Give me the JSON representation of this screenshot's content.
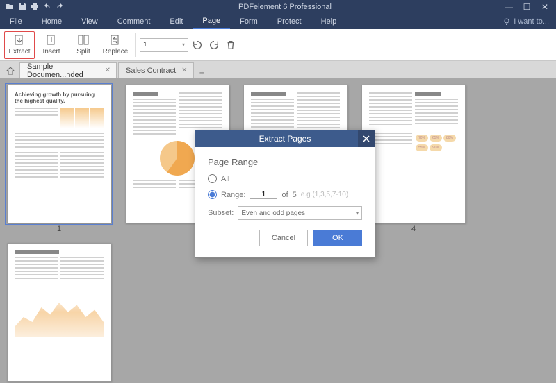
{
  "app_title": "PDFelement 6 Professional",
  "menu": {
    "items": [
      "File",
      "Home",
      "View",
      "Comment",
      "Edit",
      "Page",
      "Form",
      "Protect",
      "Help"
    ],
    "active": "Page",
    "iwant": "I want to..."
  },
  "ribbon": {
    "tools": [
      {
        "name": "extract",
        "label": "Extract",
        "highlight": true
      },
      {
        "name": "insert",
        "label": "Insert"
      },
      {
        "name": "split",
        "label": "Split"
      },
      {
        "name": "replace",
        "label": "Replace"
      }
    ],
    "page_display": "1"
  },
  "tabs": {
    "items": [
      {
        "label": "Sample Documen...nded",
        "active": true
      },
      {
        "label": "Sales Contract",
        "active": false
      }
    ]
  },
  "thumbnails": {
    "pages": [
      {
        "num": "1",
        "selected": true,
        "title": "Achieving growth by pursuing the highest quality."
      },
      {
        "num": "",
        "selected": false
      },
      {
        "num": "",
        "selected": false
      },
      {
        "num": "4",
        "selected": false
      },
      {
        "num": "",
        "selected": false
      }
    ]
  },
  "dialog": {
    "title": "Extract Pages",
    "heading": "Page Range",
    "opt_all": "All",
    "opt_range": "Range:",
    "range_value": "1",
    "of_label": "of",
    "total_pages": "5",
    "hint": "e.g.(1,3,5,7-10)",
    "subset_label": "Subset:",
    "subset_value": "Even and odd pages",
    "btn_cancel": "Cancel",
    "btn_ok": "OK"
  }
}
